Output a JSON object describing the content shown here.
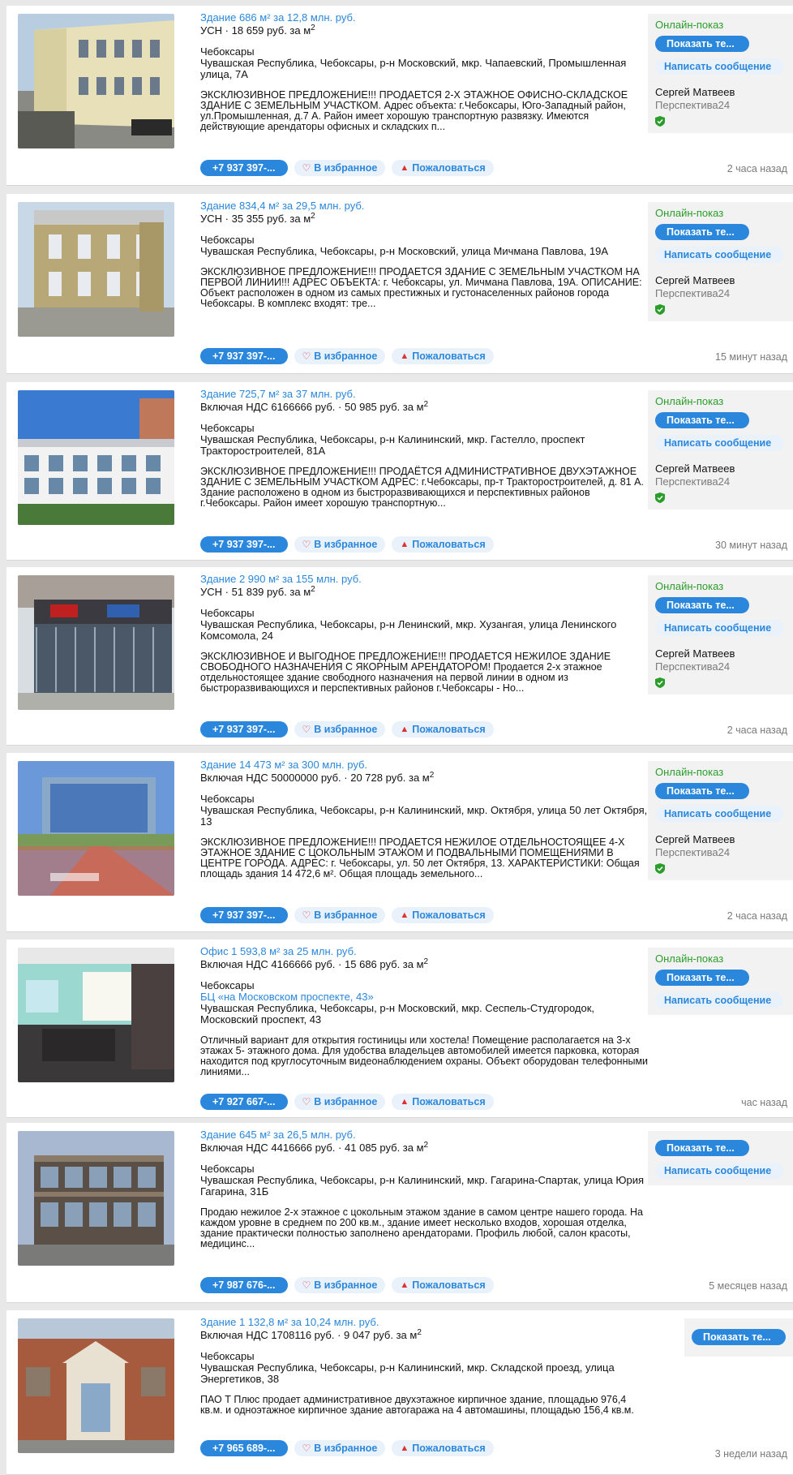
{
  "listings": [
    {
      "title": "Здание 686 м² за 12,8 млн. руб.",
      "price_prefix": "УСН",
      "price_per_m2": "18 659 руб. за м",
      "city": "Чебоксары",
      "bc": "",
      "address": "Чувашская Республика, Чебоксары, р-н Московский, мкр. Чапаевский, Промышленная улица, 7А",
      "description": "ЭКСКЛЮЗИВНОЕ ПРЕДЛОЖЕНИЕ!!! ПРОДАЕТСЯ 2-Х ЭТАЖНОЕ ОФИСНО-СКЛАДСКОЕ ЗДАНИЕ С ЗЕМЕЛЬНЫМ УЧАСТКОМ. Адрес объекта: г.Чебоксары, Юго-Западный район, ул.Промышленная, д.7 А. Район имеет хорошую транспортную развязку. Имеются действующие арендаторы офисных и складских п...",
      "phone": "+7 937 397-...",
      "online": "Онлайн-показ",
      "show_phone": "Показать те...",
      "message": "Написать сообщение",
      "agent": "Сергей Матвеев",
      "agency": "Перспектива24",
      "time": "2 часа назад"
    },
    {
      "title": "Здание 834,4 м² за 29,5 млн. руб.",
      "price_prefix": "УСН",
      "price_per_m2": "35 355 руб. за м",
      "city": "Чебоксары",
      "bc": "",
      "address": "Чувашская Республика, Чебоксары, р-н Московский, улица Мичмана Павлова, 19А",
      "description": "ЭКСКЛЮЗИВНОЕ ПРЕДЛОЖЕНИЕ!!! ПРОДАЕТСЯ ЗДАНИЕ С ЗЕМЕЛЬНЫМ УЧАСТКОМ НА ПЕРВОЙ ЛИНИИ!!! АДРЕС ОБЪЕКТА: г. Чебоксары, ул. Мичмана Павлова, 19А. ОПИСАНИЕ: Объект расположен в одном из самых престижных и густонаселенных районов города Чебоксары. В комплекс входят: тре...",
      "phone": "+7 937 397-...",
      "online": "Онлайн-показ",
      "show_phone": "Показать те...",
      "message": "Написать сообщение",
      "agent": "Сергей Матвеев",
      "agency": "Перспектива24",
      "time": "15 минут назад"
    },
    {
      "title": "Здание 725,7 м² за 37 млн. руб.",
      "price_prefix": "Включая НДС 6166666 руб.",
      "price_per_m2": "50 985 руб. за м",
      "city": "Чебоксары",
      "bc": "",
      "address": "Чувашская Республика, Чебоксары, р-н Калининский, мкр. Гастелло, проспект Тракторостроителей, 81А",
      "description": "ЭКСКЛЮЗИВНОЕ ПРЕДЛОЖЕНИЕ!!! ПРОДАЁТСЯ АДМИНИСТРАТИВНОЕ ДВУХЭТАЖНОЕ ЗДАНИЕ С ЗЕМЕЛЬНЫМ УЧАСТКОМ АДРЕС: г.Чебоксары, пр-т Тракторостроителей, д. 81 А. Здание расположено в одном из быстроразвивающихся и перспективных районов г.Чебоксары. Район имеет хорошую транспортную...",
      "phone": "+7 937 397-...",
      "online": "Онлайн-показ",
      "show_phone": "Показать те...",
      "message": "Написать сообщение",
      "agent": "Сергей Матвеев",
      "agency": "Перспектива24",
      "time": "30 минут назад"
    },
    {
      "title": "Здание 2 990 м² за 155 млн. руб.",
      "price_prefix": "УСН",
      "price_per_m2": "51 839 руб. за м",
      "city": "Чебоксары",
      "bc": "",
      "address": "Чувашская Республика, Чебоксары, р-н Ленинский, мкр. Хузангая, улица Ленинского Комсомола, 24",
      "description": "ЭКСКЛЮЗИВНОЕ И ВЫГОДНОЕ ПРЕДЛОЖЕНИЕ!!! ПРОДАЕТСЯ НЕЖИЛОЕ ЗДАНИЕ СВОБОДНОГО НАЗНАЧЕНИЯ С ЯКОРНЫМ АРЕНДАТОРОМ! Продается 2-х этажное отдельностоящее здание свободного назначения на первой линии в одном из быстроразвивающихся и перспективных районов г.Чебоксары - Но...",
      "phone": "+7 937 397-...",
      "online": "Онлайн-показ",
      "show_phone": "Показать те...",
      "message": "Написать сообщение",
      "agent": "Сергей Матвеев",
      "agency": "Перспектива24",
      "time": "2 часа назад"
    },
    {
      "title": "Здание 14 473 м² за 300 млн. руб.",
      "price_prefix": "Включая НДС 50000000 руб.",
      "price_per_m2": "20 728 руб. за м",
      "city": "Чебоксары",
      "bc": "",
      "address": "Чувашская Республика, Чебоксары, р-н Калининский, мкр. Октября, улица 50 лет Октября, 13",
      "description": "ЭКСКЛЮЗИВНОЕ ПРЕДЛОЖЕНИЕ!!! ПРОДАЕТСЯ НЕЖИЛОЕ ОТДЕЛЬНОСТОЯЩЕЕ 4-Х ЭТАЖНОЕ ЗДАНИЕ С ЦОКОЛЬНЫМ ЭТАЖОМ И ПОДВАЛЬНЫМИ ПОМЕЩЕНИЯМИ В ЦЕНТРЕ ГОРОДА. АДРЕС: г. Чебоксары, ул. 50 лет Октября, 13. ХАРАКТЕРИСТИКИ: Общая площадь здания 14 472,6 м². Общая площадь земельного...",
      "phone": "+7 937 397-...",
      "online": "Онлайн-показ",
      "show_phone": "Показать те...",
      "message": "Написать сообщение",
      "agent": "Сергей Матвеев",
      "agency": "Перспектива24",
      "time": "2 часа назад"
    },
    {
      "title": "Офис 1 593,8 м² за 25 млн. руб.",
      "price_prefix": "Включая НДС 4166666 руб.",
      "price_per_m2": "15 686 руб. за м",
      "city": "Чебоксары",
      "bc": "БЦ «на Московском проспекте, 43»",
      "address": "Чувашская Республика, Чебоксары, р-н Московский, мкр. Сеспель-Студгородок, Московский проспект, 43",
      "description": "Отличный вариант для открытия гостиницы или хостела! Помещение располагается на 3-х этажах 5- этажного дома. Для удобства владельцев автомобилей имеется парковка, которая находится под круглосуточным видеонаблюдением охраны. Объект оборудован телефонными линиями...",
      "phone": "+7 927 667-...",
      "online": "Онлайн-показ",
      "show_phone": "Показать те...",
      "message": "Написать сообщение",
      "agent": "",
      "agency": "",
      "time": "час назад"
    },
    {
      "title": "Здание 645 м² за 26,5 млн. руб.",
      "price_prefix": "Включая НДС 4416666 руб.",
      "price_per_m2": "41 085 руб. за м",
      "city": "Чебоксары",
      "bc": "",
      "address": "Чувашская Республика, Чебоксары, р-н Калининский, мкр. Гагарина-Спартак, улица Юрия Гагарина, 31Б",
      "description": "Продаю нежилое 2-х этажное с цокольным этажом здание в самом центре нашего города. На каждом уровне в среднем по 200 кв.м., здание имеет несколько входов, хорошая отделка, здание практически полностью заполнено арендаторами. Профиль любой, салон красоты, медицинс...",
      "phone": "+7 987 676-...",
      "online": "",
      "show_phone": "Показать те...",
      "message": "Написать сообщение",
      "agent": "",
      "agency": "",
      "time": "5 месяцев назад"
    },
    {
      "title": "Здание 1 132,8 м² за 10,24 млн. руб.",
      "price_prefix": "Включая НДС 1708116 руб.",
      "price_per_m2": "9 047 руб. за м",
      "city": "Чебоксары",
      "bc": "",
      "address": "Чувашская Республика, Чебоксары, р-н Калининский, мкр. Складской проезд, улица Энергетиков, 38",
      "description": "ПАО Т Плюс продает административное двухэтажное кирпичное здание, площадью 976,4 кв.м. и одноэтажное кирпичное здание автогаража на 4 автомашины, площадью 156,4 кв.м.",
      "phone": "+7 965 689-...",
      "online": "",
      "show_phone": "Показать те...",
      "message": "",
      "agent": "",
      "agency": "",
      "time": "3 недели назад"
    }
  ],
  "labels": {
    "dot": "·",
    "sup": "2",
    "favorite": "В избранное",
    "complain": "Пожаловаться",
    "heart_glyph": "♡",
    "warn_glyph": "▲"
  },
  "colors": {
    "accent": "#2b87db",
    "online": "#2a9d2a",
    "danger": "#e03030",
    "muted": "#7a7a7a"
  }
}
